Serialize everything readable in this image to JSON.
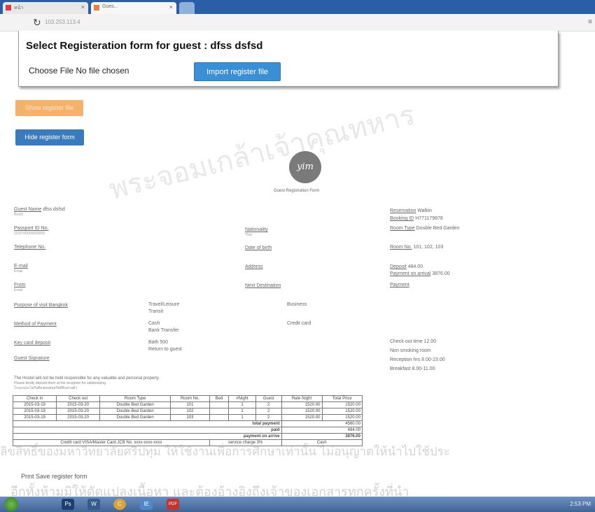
{
  "browser": {
    "tabs": [
      {
        "label": "หน้า"
      },
      {
        "label": "Gues..."
      }
    ],
    "url": "103.253.113.4",
    "reload_icon": "reload-icon",
    "menu_icon": "menu-dots-icon"
  },
  "modal": {
    "title": "Select Registeration form for guest : dfss dsfsd",
    "choose_file": "Choose File",
    "file_status": "No file chosen",
    "import_button": "Import register file"
  },
  "buttons": {
    "show": "Show register file",
    "hide": "Hide register form"
  },
  "form": {
    "logo_text": "yim",
    "title": "Guest Registration Form",
    "guest_name_label": "Guest Name",
    "guest_name_value": "dfss dsfsd",
    "guest_name_sub": "Room",
    "passport_label": "Passport ID No.",
    "passport_value": "1103700000000000",
    "telephone_label": "Telephone No.",
    "email_label": "E-mail",
    "email_sub": "Email",
    "from_label": "From",
    "from_sub": "Email",
    "nationality_label": "Nationality",
    "nationality_sub": "Thai",
    "dob_label": "Date of birth",
    "address_label": "Address",
    "next_destination_label": "Next Destination",
    "reservation_label": "Reservation",
    "reservation_value": "Walkin",
    "booking_label": "Booking ID",
    "booking_value": "H771179878",
    "room_type_label": "Room Type",
    "room_type_value": "Double Bed Garden",
    "room_no_label": "Room No.",
    "room_no_value": "101, 102, 103",
    "deposit_label": "Deposit",
    "deposit_value": "484.00",
    "payment_arrival_label": "Payment on arrival",
    "payment_arrival_value": "3876.00",
    "payment_label": "Payment",
    "purpose_label": "Purpose of visit Bangkok",
    "purpose_opt1": "Travel/Leisure",
    "purpose_opt2": "Transit",
    "purpose_opt3": "Business",
    "method_label": "Method of Payment",
    "method_opt1": "Cash",
    "method_opt2": "Bank Transfer",
    "method_opt3": "Credit card",
    "key_deposit_label": "Key card deposit",
    "key_deposit_v1": "Bath 500",
    "key_deposit_v2": "Return to guest",
    "guest_signature_label": "Guest Signature",
    "checkout_time": "Check out time 12.00",
    "non_smoking": "Non smoking room",
    "reception_hrs": "Reception hrs 8.00-23.00",
    "breakfast": "Breakfast 8.00-11.00",
    "disclaimer1": "The Hostel will not be held responsible for any valuable and personal property.",
    "disclaimer2": "Please kindly deposit them at the reception for safekeeping.",
    "disclaimer3": "โรงแรมจะไม่รับผิดชอบต่อทรัพย์สินส่วนตัว"
  },
  "booking_table": {
    "headers": [
      "Check in",
      "Check out",
      "Room Type",
      "Room No.",
      "Bed",
      "#Night",
      "Guest",
      "Rate Night",
      "Total Price"
    ],
    "rows": [
      [
        "2015-03-19",
        "2015-03-20",
        "Double Bed Garden",
        "101",
        "",
        "1",
        "2",
        "1520.00",
        "1520.00"
      ],
      [
        "2015-03-19",
        "2015-03-20",
        "Double Bed Garden",
        "102",
        "",
        "1",
        "2",
        "1520.00",
        "1520.00"
      ],
      [
        "2015-03-19",
        "2015-03-20",
        "Double Bed Garden",
        "103",
        "",
        "1",
        "2",
        "1520.00",
        "1520.00"
      ]
    ],
    "total_label": "total payment",
    "total_value": "4560.00",
    "paid_label": "paid",
    "paid_value": "484.00",
    "arrive_label": "payment on arrive",
    "arrive_value": "3876.00",
    "card_text": "Credit card VISA/Master Card JCB No. xxxx-xxxx-xxxx",
    "service_charge": "service charge 3%",
    "cash": "Cash"
  },
  "print_link": "Print Save register form",
  "watermark": {
    "line1": "ลิขสิทธิ์ของมหาวิทยาลัยศรีปทุม ให้ใช้งานเพื่อการศึกษาเท่านั้น ไม่อนุญาตให้นำไปใช้ประ",
    "line2": "อีกทั้งห้ามมิให้ดัดแปลงเนื้อหา และต้องอ้างอิงถึงเจ้าของเอกสารทุกครั้งที่นำ",
    "seal_text": "พระจอมเกล้าเจ้าคุณทหาร"
  },
  "taskbar": {
    "start_icon": "windows-start-icon",
    "items": [
      "Ps",
      "W",
      "C",
      "IE",
      "PDF"
    ],
    "tray": "2:53 PM"
  }
}
